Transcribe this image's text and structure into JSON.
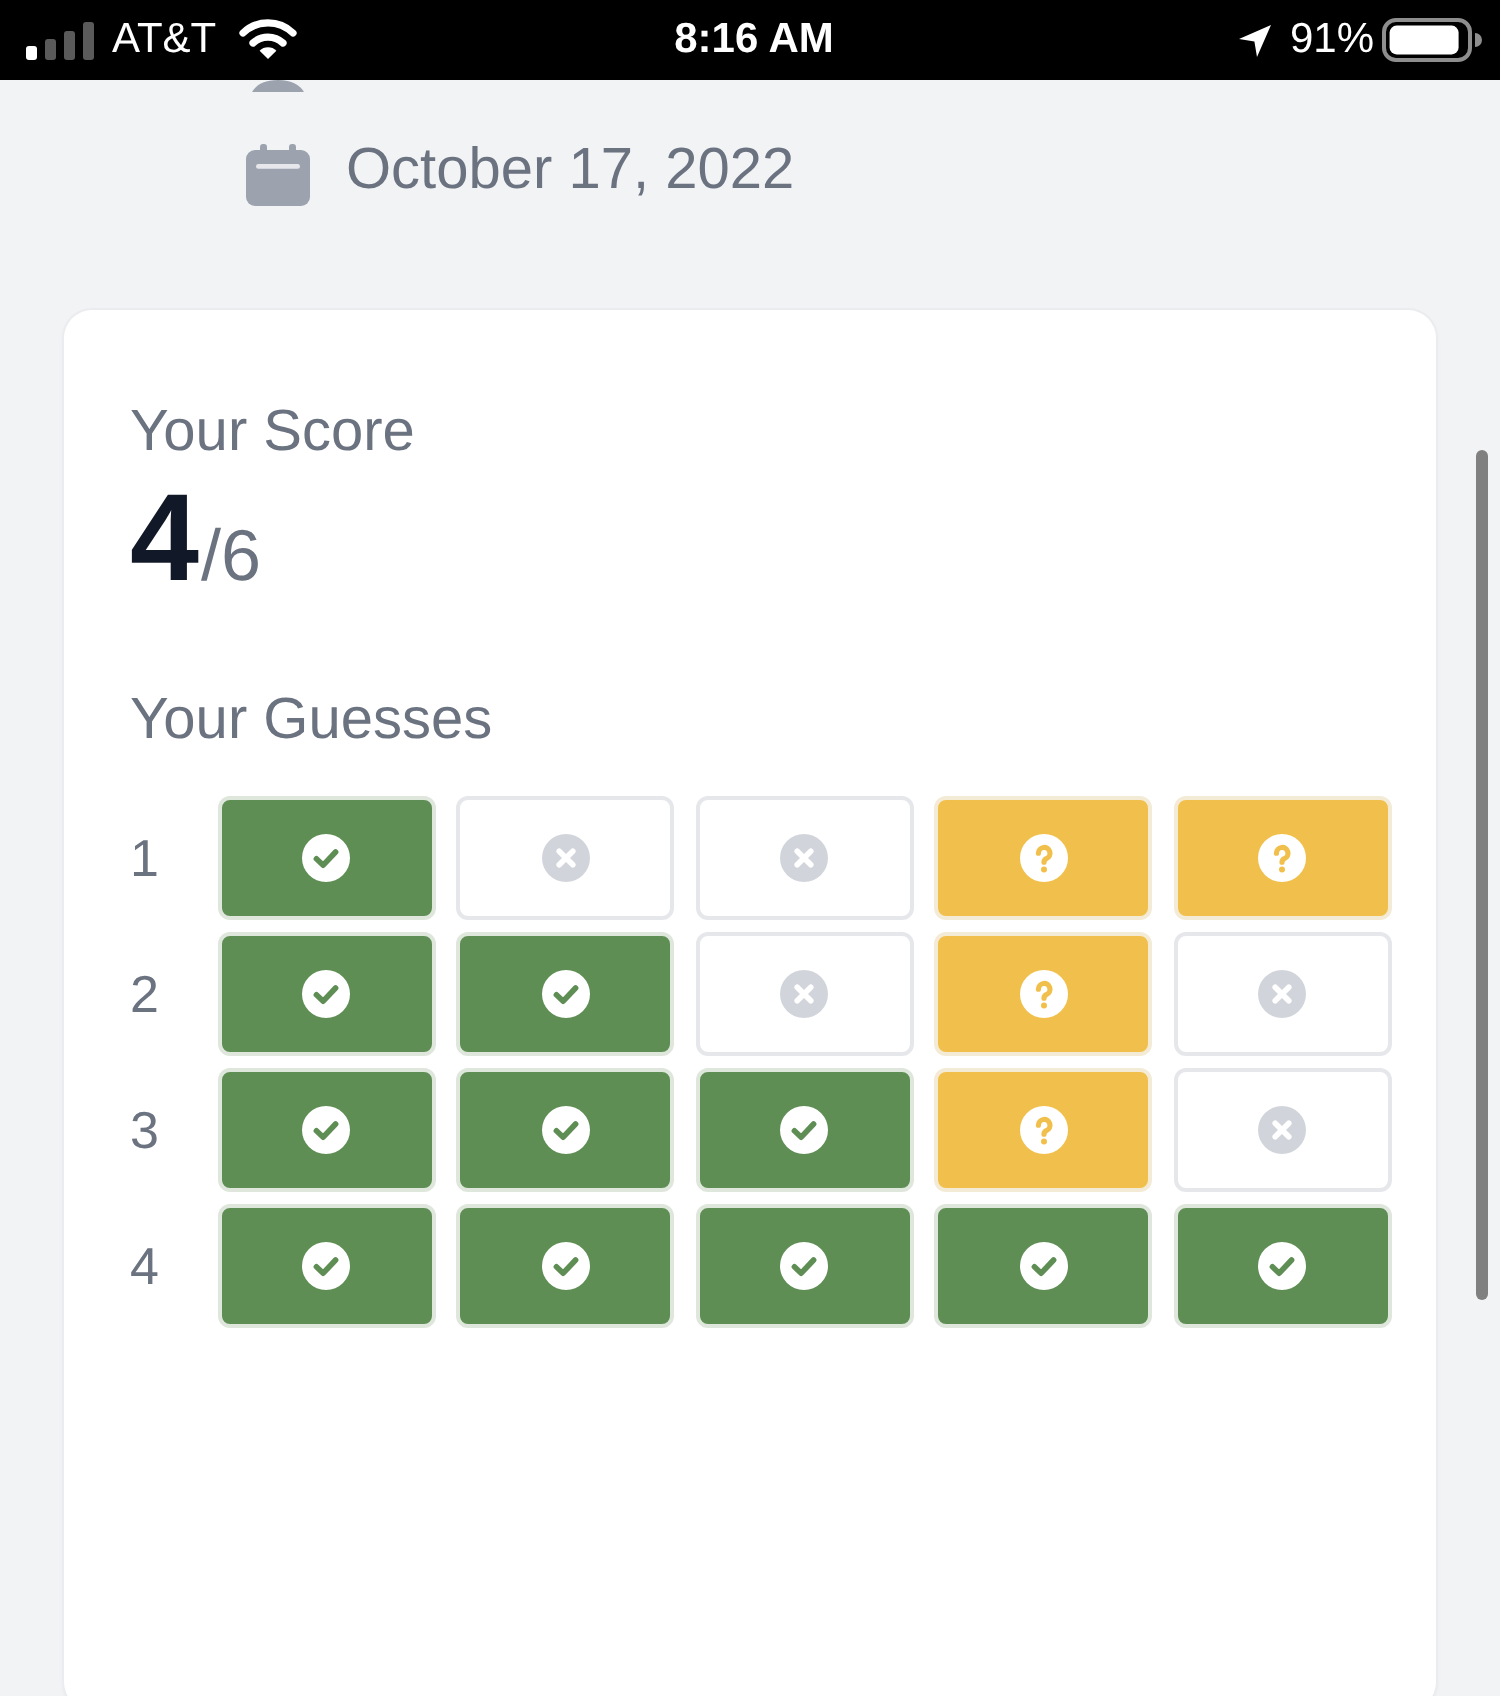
{
  "status_bar": {
    "carrier": "AT&T",
    "time": "8:16 AM",
    "battery_percent": "91%"
  },
  "event": {
    "date": "October 17, 2022"
  },
  "score": {
    "label": "Your Score",
    "value": "4",
    "total": "/6"
  },
  "guesses": {
    "label": "Your Guesses",
    "rows": [
      {
        "number": "1",
        "tiles": [
          {
            "kind": "correct"
          },
          {
            "kind": "absent"
          },
          {
            "kind": "absent"
          },
          {
            "kind": "present"
          },
          {
            "kind": "present"
          }
        ]
      },
      {
        "number": "2",
        "tiles": [
          {
            "kind": "correct"
          },
          {
            "kind": "correct"
          },
          {
            "kind": "absent"
          },
          {
            "kind": "present"
          },
          {
            "kind": "absent"
          }
        ]
      },
      {
        "number": "3",
        "tiles": [
          {
            "kind": "correct"
          },
          {
            "kind": "correct"
          },
          {
            "kind": "correct"
          },
          {
            "kind": "present"
          },
          {
            "kind": "absent"
          }
        ]
      },
      {
        "number": "4",
        "tiles": [
          {
            "kind": "correct"
          },
          {
            "kind": "correct"
          },
          {
            "kind": "correct"
          },
          {
            "kind": "correct"
          },
          {
            "kind": "correct"
          }
        ]
      }
    ]
  }
}
